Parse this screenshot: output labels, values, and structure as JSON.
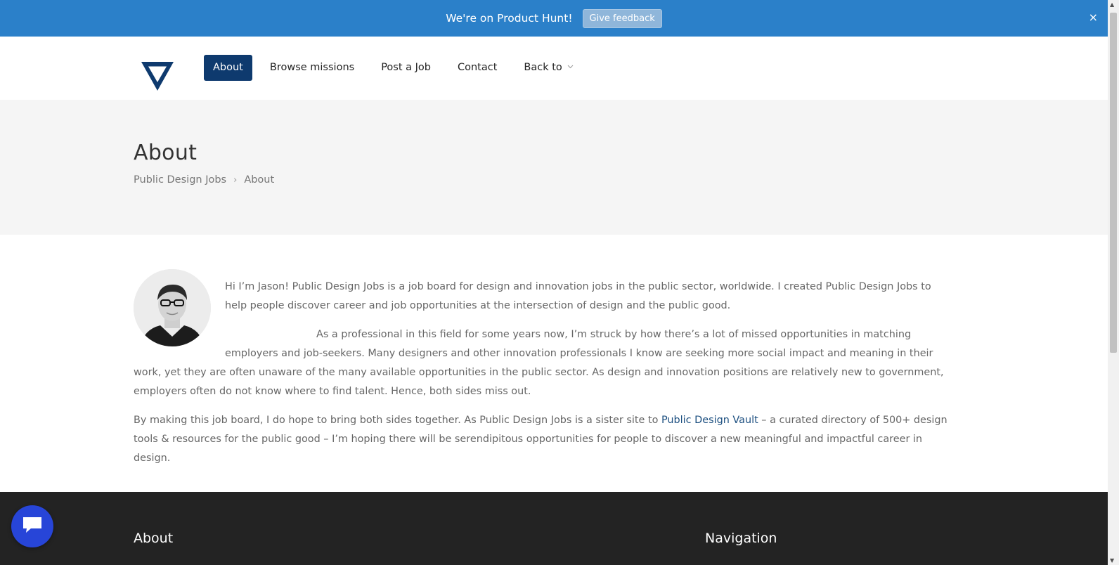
{
  "promo": {
    "text": "We're on Product Hunt!",
    "button_label": "Give feedback",
    "close_label": "×"
  },
  "nav": {
    "items": [
      {
        "label": "About",
        "active": true
      },
      {
        "label": "Browse missions"
      },
      {
        "label": "Post a Job"
      },
      {
        "label": "Contact"
      },
      {
        "label": "Back to",
        "dropdown": true
      }
    ]
  },
  "hero": {
    "title": "About",
    "breadcrumb": [
      "Public Design Jobs",
      "About"
    ],
    "breadcrumb_sep": "›"
  },
  "content": {
    "p1": "Hi I’m Jason! Public Design Jobs is a job board for design and innovation jobs in the public sector, worldwide. I created Public Design Jobs to help people discover career and job opportunities at the intersection of design and the public good.",
    "p2": "As a professional in this field for some years now, I’m struck by how there’s a lot of missed opportunities in matching employers and job-seekers. Many designers and other innovation professionals I know are seeking more social impact and meaning in their work, yet they are often unaware of the many available opportunities in the public sector. As design and innovation positions are relatively new to government, employers often do not know where to find talent. Hence, both sides miss out.",
    "p3_before": "By making this job board, I do hope to bring both sides together. As Public Design Jobs is a sister site to ",
    "p3_link": "Public Design Vault",
    "p3_after": " – a curated directory of 500+ design tools & resources for the public good – I’m hoping there will be serendipitous opportunities for people to discover a new meaningful and impactful career in design."
  },
  "footer": {
    "col1_title": "About",
    "col2_title": "Navigation"
  },
  "colors": {
    "promo_bg": "#2b80c9",
    "nav_active": "#0e3a6e",
    "footer_bg": "#232323",
    "chat_fab": "#2745d8"
  },
  "icons": {
    "logo": "inverted-triangle-logo",
    "chat": "chat-bubble-icon",
    "dropdown": "chevron-down-icon"
  }
}
